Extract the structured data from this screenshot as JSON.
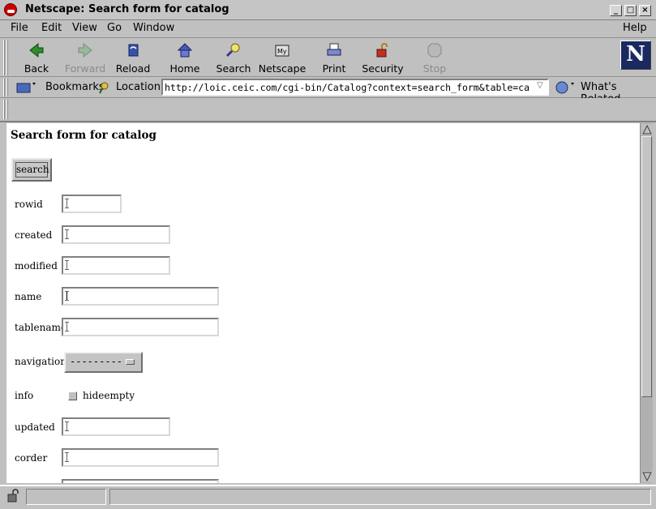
{
  "window": {
    "title": "Netscape: Search form for catalog"
  },
  "menu": [
    "File",
    "Edit",
    "View",
    "Go",
    "Window"
  ],
  "menu_help": "Help",
  "toolbar": [
    {
      "label": "Back",
      "icon": "back-icon",
      "enabled": true
    },
    {
      "label": "Forward",
      "icon": "forward-icon",
      "enabled": false
    },
    {
      "label": "Reload",
      "icon": "reload-icon",
      "enabled": true
    },
    {
      "label": "Home",
      "icon": "home-icon",
      "enabled": true
    },
    {
      "label": "Search",
      "icon": "search-icon",
      "enabled": true
    },
    {
      "label": "Netscape",
      "icon": "netscape-icon",
      "enabled": true
    },
    {
      "label": "Print",
      "icon": "print-icon",
      "enabled": true
    },
    {
      "label": "Security",
      "icon": "security-icon",
      "enabled": true
    },
    {
      "label": "Stop",
      "icon": "stop-icon",
      "enabled": false
    }
  ],
  "location": {
    "bookmarks_label": "Bookmarks",
    "location_label": "Location:",
    "url": "http://loic.ceic.com/cgi-bin/Catalog?context=search_form&table=ca",
    "whats_related": "What's Related"
  },
  "page": {
    "heading": "Search form for catalog",
    "search_button": "search",
    "fields": {
      "rowid": "rowid",
      "created": "created",
      "modified": "modified",
      "name": "name",
      "tablename": "tablename",
      "navigation": "navigation",
      "info": "info",
      "updated": "updated",
      "corder": "corder"
    },
    "navigation_value": "---------",
    "hideempty_label": "hideempty"
  },
  "colors": {
    "background": "#c0c0c0",
    "content_bg": "#ffffff",
    "netscape_logo_bg": "#1a2a60"
  }
}
